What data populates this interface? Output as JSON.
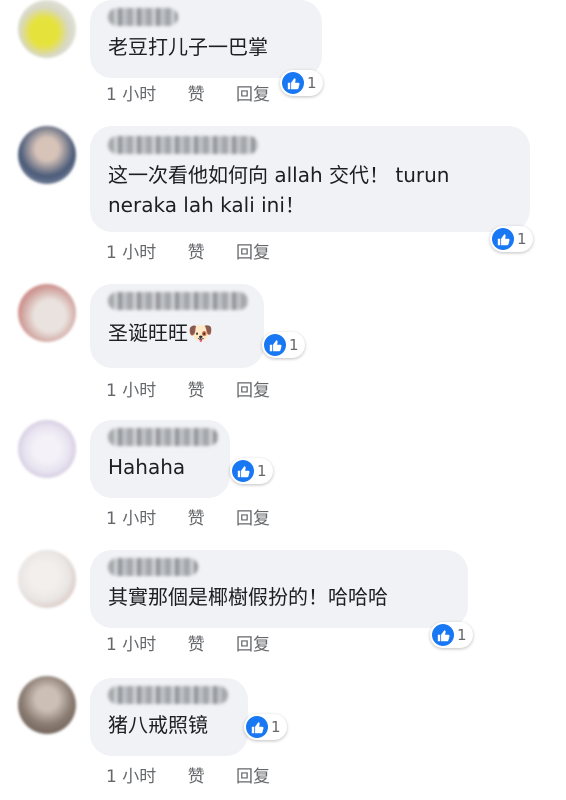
{
  "labels": {
    "like": "赞",
    "reply": "回复"
  },
  "colors": {
    "bubble": "#f0f2f5",
    "meta": "#65676b",
    "like_blue": "#1877f2"
  },
  "comments": [
    {
      "text": "老豆打儿子一巴掌",
      "time": "1 小时",
      "reactions": "1",
      "avatar_colors": [
        "#d8d8c8",
        "#e6e23c"
      ]
    },
    {
      "text": "这一次看他如何向 allah 交代！ turun\nneraka lah kali ini！",
      "time": "1 小时",
      "reactions": "1",
      "avatar_colors": [
        "#d7c3b8",
        "#4b5b79"
      ]
    },
    {
      "text": "圣诞旺旺🐶",
      "time": "1 小时",
      "reactions": "1",
      "avatar_colors": [
        "#e9e2de",
        "#c34a4a"
      ]
    },
    {
      "text": "Hahaha",
      "time": "1 小时",
      "reactions": "1",
      "avatar_colors": [
        "#e8e3f0",
        "#b9aac9"
      ]
    },
    {
      "text": "其實那個是椰樹假扮的！哈哈哈",
      "time": "1 小时",
      "reactions": "1",
      "avatar_colors": [
        "#e9e6e4",
        "#caa89e"
      ]
    },
    {
      "text": "猪八戒照镜",
      "time": "1 小时",
      "reactions": "1",
      "avatar_colors": [
        "#8c7d73",
        "#cbbfb6"
      ]
    }
  ]
}
